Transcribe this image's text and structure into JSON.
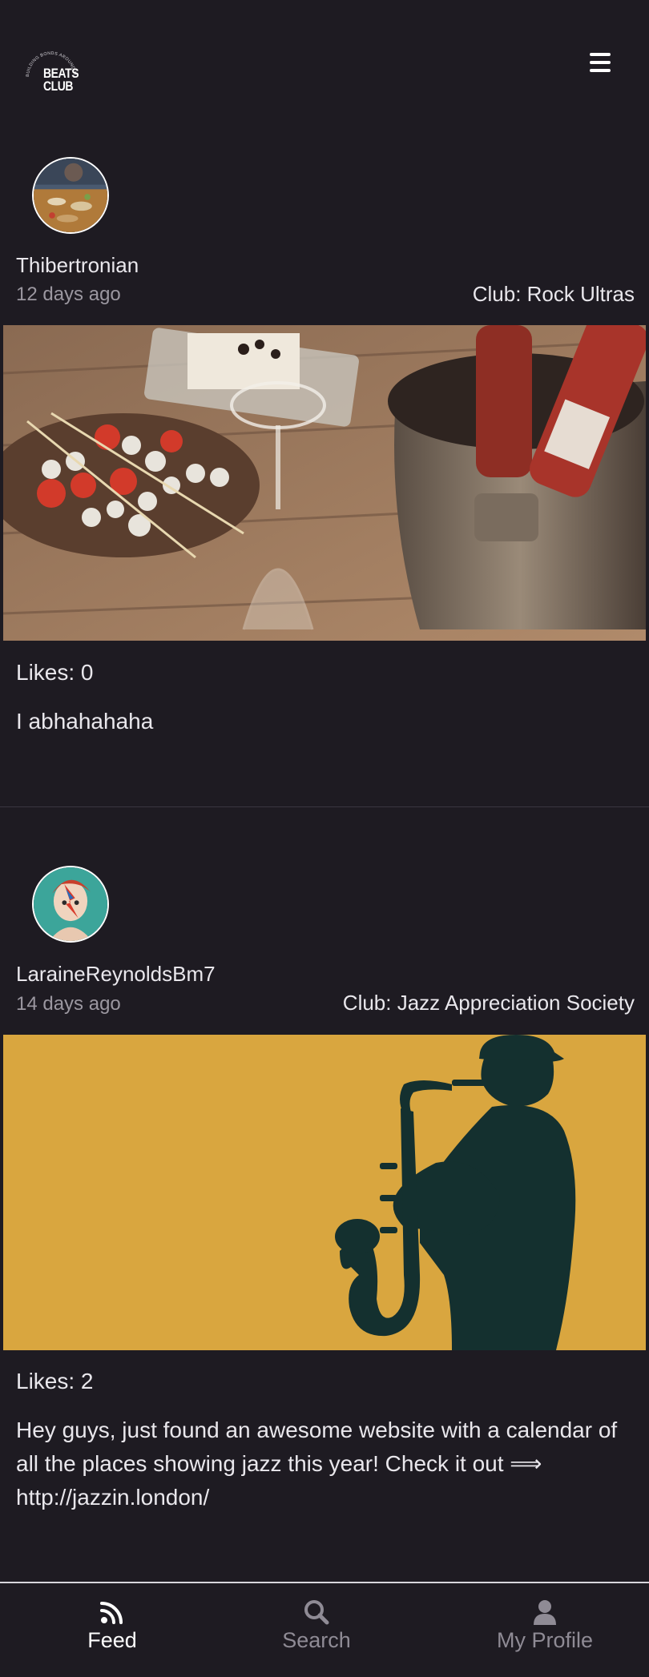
{
  "app": {
    "logo_text_line1": "BEATS",
    "logo_text_line2": "CLUB",
    "logo_ring_text": "BUILDING BONDS AROUND MUSIC"
  },
  "header": {
    "menu_icon": "hamburger-menu-icon"
  },
  "posts": [
    {
      "username": "Thibertronian",
      "time": "12 days ago",
      "club": "Club: Rock Ultras",
      "likes": "Likes: 0",
      "text": "I abhahahaha",
      "image_desc_icon": "food-and-wine-photo",
      "avatar_icon": "food-table-avatar"
    },
    {
      "username": "LaraineReynoldsBm7",
      "time": "14 days ago",
      "club": "Club: Jazz Appreciation Society",
      "likes": "Likes: 2",
      "text": "Hey guys, just found an awesome website with a calendar of all the places showing jazz this year! Check it out ⟹ http://jazzin.london/",
      "image_desc_icon": "saxophone-player-silhouette",
      "avatar_icon": "bowie-portrait-avatar"
    }
  ],
  "nav": {
    "items": [
      {
        "label": "Feed",
        "icon": "rss-feed-icon",
        "active": true
      },
      {
        "label": "Search",
        "icon": "search-icon",
        "active": false
      },
      {
        "label": "My Profile",
        "icon": "user-icon",
        "active": false
      }
    ]
  },
  "colors": {
    "background": "#1e1b22",
    "text": "#e9e7ec",
    "muted": "#9b97a0",
    "jazz_yellow": "#d9a63f",
    "silhouette": "#14302f"
  }
}
